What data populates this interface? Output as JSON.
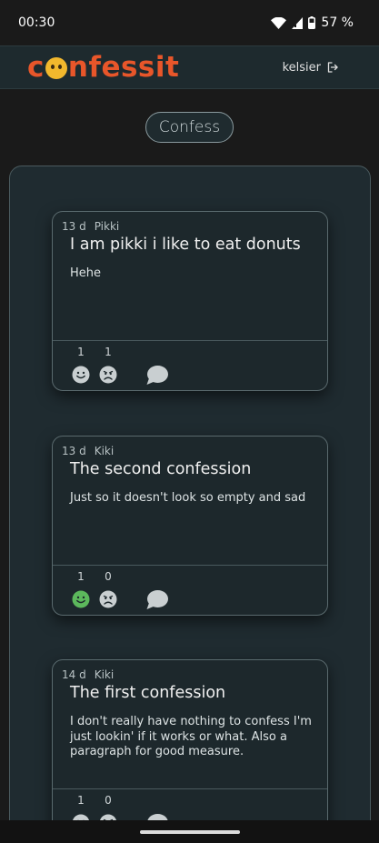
{
  "status_bar": {
    "time": "00:30",
    "battery": "57 %"
  },
  "header": {
    "logo_parts": [
      "c",
      "nfessit"
    ],
    "username": "kelsier",
    "logout_icon": "logout-icon"
  },
  "confess_button_label": "Confess",
  "colors": {
    "accent": "#e8562a",
    "like_active": "#5cb85c",
    "reaction_inactive": "#c9cfd1"
  },
  "confessions": [
    {
      "age": "13 d",
      "author": "Pikki",
      "title": "I am pikki i like to eat donuts",
      "body": "Hehe",
      "likes": "1",
      "dislikes": "1",
      "liked": false
    },
    {
      "age": "13 d",
      "author": "Kiki",
      "title": "The second confession",
      "body": "Just so it doesn't look so empty and sad",
      "likes": "1",
      "dislikes": "0",
      "liked": true
    },
    {
      "age": "14 d",
      "author": "Kiki",
      "title": "The first confession",
      "body": "I don't really have nothing to confess I'm just lookin' if it works or what. Also a paragraph for good measure.",
      "likes": "1",
      "dislikes": "0",
      "liked": false
    }
  ]
}
